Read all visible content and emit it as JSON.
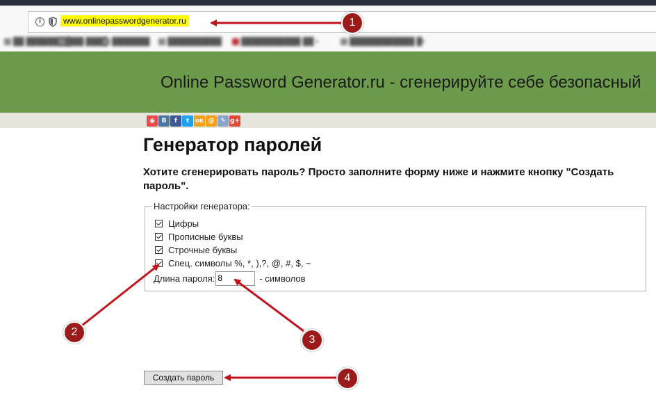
{
  "browser": {
    "url": "www.onlinepasswordgenerator.ru"
  },
  "header": {
    "banner_title": "Online Password Generator.ru - сгенерируйте себе безопасный"
  },
  "share_icons": [
    "pocket-icon",
    "vk-icon",
    "facebook-icon",
    "twitter-icon",
    "odnoklassniki-icon",
    "mailru-icon",
    "livejournal-icon",
    "googleplus-icon"
  ],
  "main": {
    "title": "Генератор паролей",
    "intro": "Хотите сгенерировать пароль? Просто заполните форму ниже и нажмите кнопку \"Создать пароль\".",
    "settings": {
      "legend": "Настройки генератора:",
      "options": [
        {
          "label": "Цифры",
          "checked": true
        },
        {
          "label": "Прописные буквы",
          "checked": true
        },
        {
          "label": "Строчные буквы",
          "checked": true
        },
        {
          "label": "Спец. символы %, *, ),?, @, #, $, ~",
          "checked": true
        }
      ],
      "length_label": "Длина пароля:",
      "length_value": "8",
      "length_suffix": "- символов"
    },
    "generate_button": "Создать пароль"
  },
  "annotations": {
    "badges": [
      "1",
      "2",
      "3",
      "4"
    ],
    "color": "#c0131c"
  }
}
